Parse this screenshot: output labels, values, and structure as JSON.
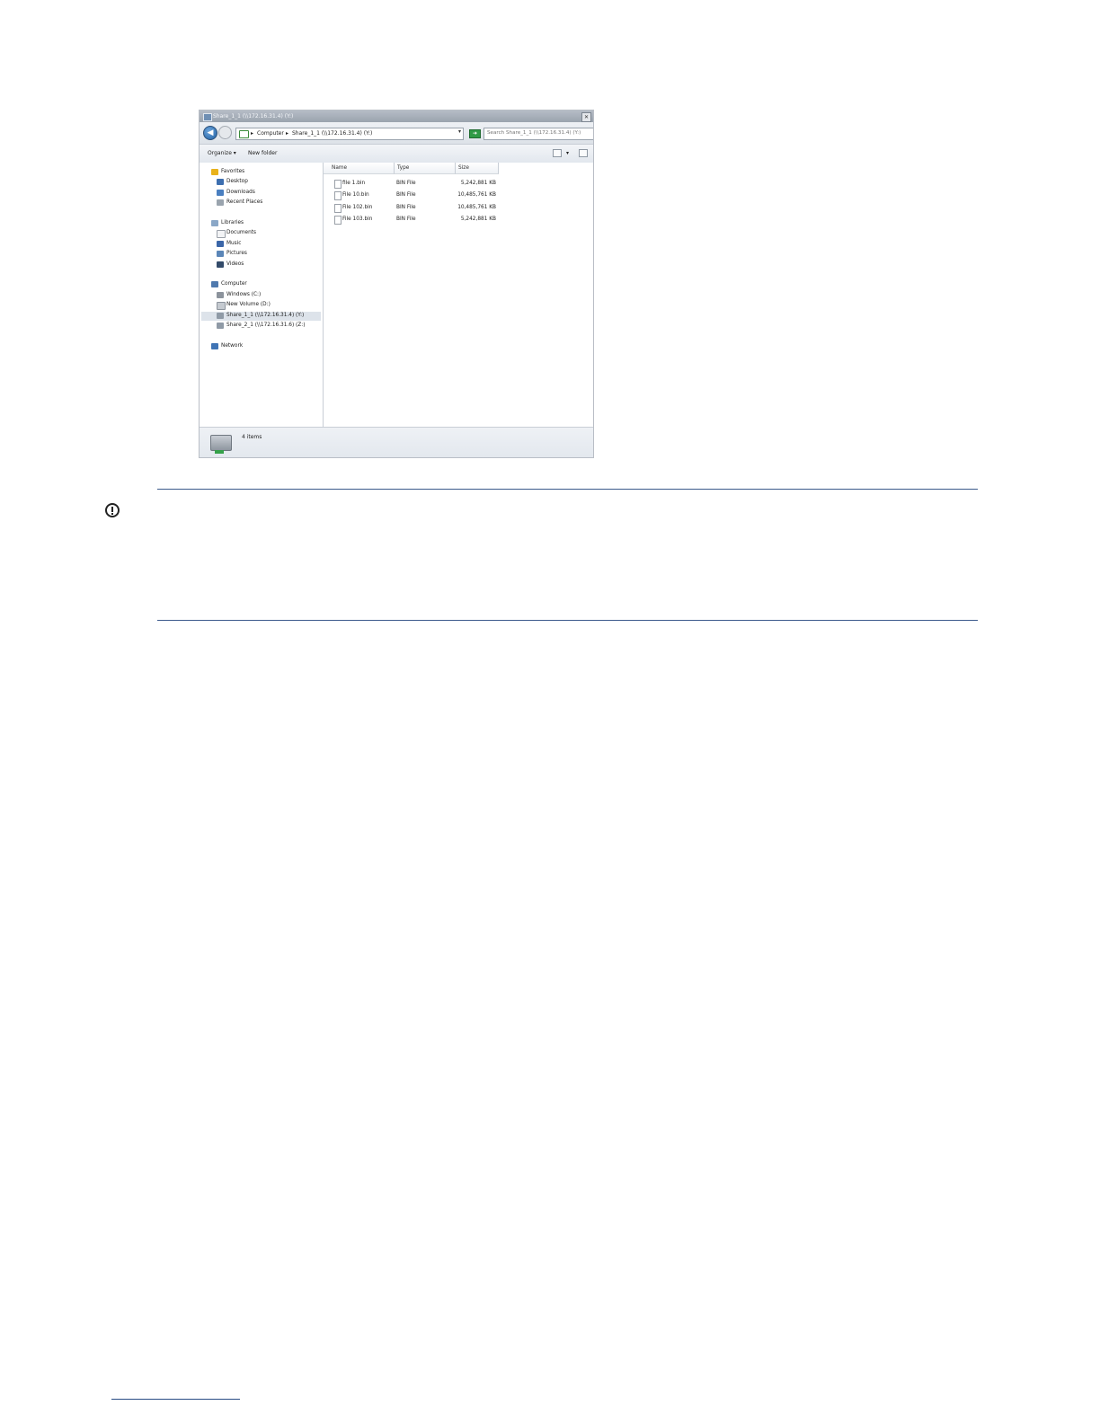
{
  "explorer": {
    "window_title": "Share_1_1 (\\\\172.16.31.4) (Y:)",
    "address": {
      "crumbs": [
        "Computer",
        "Share_1_1 (\\\\172.16.31.4) (Y:)"
      ],
      "separator": "▸"
    },
    "search_placeholder": "Search Share_1_1 (\\\\172.16.31.4) (Y:)",
    "toolbar": {
      "organize": "Organize ▾",
      "new_folder": "New folder"
    },
    "nav": {
      "favorites": "Favorites",
      "desktop": "Desktop",
      "downloads": "Downloads",
      "recent_places": "Recent Places",
      "libraries": "Libraries",
      "documents": "Documents",
      "music": "Music",
      "pictures": "Pictures",
      "videos": "Videos",
      "computer": "Computer",
      "windows_c": "Windows (C:)",
      "new_volume_d": "New Volume (D:)",
      "share_1_1": "Share_1_1 (\\\\172.16.31.4) (Y:)",
      "share_2_1": "Share_2_1 (\\\\172.16.31.6) (Z:)",
      "network": "Network"
    },
    "columns": {
      "name": "Name",
      "type": "Type",
      "size": "Size"
    },
    "files": [
      {
        "name": "file 1.bin",
        "type": "BIN File",
        "size": "5,242,881 KB"
      },
      {
        "name": "File 10.bin",
        "type": "BIN File",
        "size": "10,485,761 KB"
      },
      {
        "name": "File 102.bin",
        "type": "BIN File",
        "size": "10,485,761 KB"
      },
      {
        "name": "File 103.bin",
        "type": "BIN File",
        "size": "5,242,881 KB"
      }
    ],
    "status": {
      "items": "4 items"
    }
  },
  "colors": {
    "rule": "#3c5a8c",
    "selected_row": "#dde3ea"
  },
  "icons": {
    "callout": "important-icon"
  }
}
